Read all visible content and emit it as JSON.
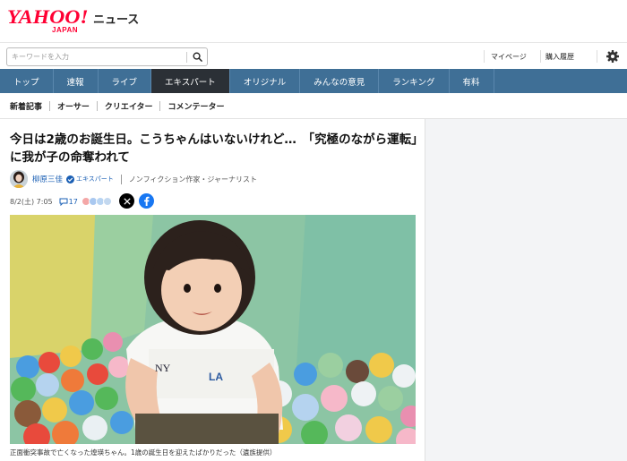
{
  "header": {
    "logo_yahoo": "YAHOO!",
    "logo_japan": "JAPAN",
    "logo_news": "ニュース",
    "search_placeholder": "キーワードを入力",
    "mypage_label": "マイページ",
    "history_label": "購入履歴",
    "brand_color": "#ff0033"
  },
  "nav": {
    "items": [
      "トップ",
      "速報",
      "ライブ",
      "エキスパート",
      "オリジナル",
      "みんなの意見",
      "ランキング",
      "有料"
    ],
    "active": "エキスパート",
    "bar_color": "#3f6f96"
  },
  "subnav": {
    "items": [
      "新着記事",
      "オーサー",
      "クリエイター",
      "コメンテーター"
    ]
  },
  "article": {
    "title": "今日は2歳のお誕生日。こうちゃんはいないけれど…　「究極のながら運転」に我が子の命奪われて",
    "author_name": "柳原三佳",
    "expert_label": "エキスパート",
    "author_title": "ノンフィクション作家・ジャーナリスト",
    "date": "8/2(土) 7:05",
    "comment_count": "17",
    "caption": "正面衝突事故で亡くなった煌瑛ちゃん。1歳の誕生日を迎えたばかりだった（遺族提供）"
  }
}
